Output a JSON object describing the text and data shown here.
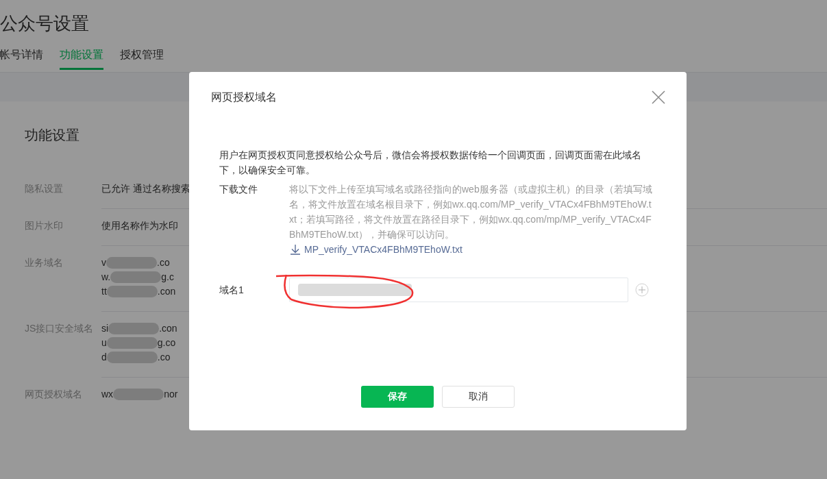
{
  "page": {
    "title": "公众号设置",
    "tabs": [
      {
        "label": "帐号详情",
        "selected": false
      },
      {
        "label": "功能设置",
        "selected": true
      },
      {
        "label": "授权管理",
        "selected": false
      }
    ],
    "section_title": "功能设置",
    "settings": [
      {
        "label": "隐私设置",
        "lines": [
          {
            "kind": "text",
            "text": "已允许 通过名称搜索"
          }
        ]
      },
      {
        "label": "图片水印",
        "lines": [
          {
            "kind": "text",
            "text": "使用名称作为水印"
          }
        ]
      },
      {
        "label": "业务域名",
        "lines": [
          {
            "kind": "redacted",
            "prefix": "v",
            "suffix": ".co"
          },
          {
            "kind": "redacted",
            "prefix": "w.",
            "suffix": "g.c"
          },
          {
            "kind": "redacted",
            "prefix": "tt",
            "suffix": ".con"
          }
        ]
      },
      {
        "label": "JS接口安全域名",
        "lines": [
          {
            "kind": "redacted",
            "prefix": "si",
            "suffix": ".con"
          },
          {
            "kind": "redacted",
            "prefix": "u",
            "suffix": "g.co"
          },
          {
            "kind": "redacted",
            "prefix": "d",
            "suffix": ".co"
          }
        ]
      },
      {
        "label": "网页授权域名",
        "lines": [
          {
            "kind": "redacted",
            "prefix": "wx",
            "suffix": "nor"
          }
        ]
      }
    ]
  },
  "dialog": {
    "title": "网页授权域名",
    "description": "用户在网页授权页同意授权给公众号后，微信会将授权数据传给一个回调页面，回调页面需在此域名下，以确保安全可靠。",
    "download": {
      "label": "下载文件",
      "instructions": "将以下文件上传至填写域名或路径指向的web服务器（或虚拟主机）的目录（若填写域名，将文件放置在域名根目录下，例如wx.qq.com/MP_verify_VTACx4FBhM9TEhoW.txt；若填写路径，将文件放置在路径目录下，例如wx.qq.com/mp/MP_verify_VTACx4FBhM9TEhoW.txt），并确保可以访问。",
      "file_link": "MP_verify_VTACx4FBhM9TEhoW.txt"
    },
    "domains": [
      {
        "label": "域名1"
      }
    ],
    "buttons": [
      {
        "label": "保存",
        "kind": "primary"
      },
      {
        "label": "取消",
        "kind": "secondary"
      }
    ]
  }
}
